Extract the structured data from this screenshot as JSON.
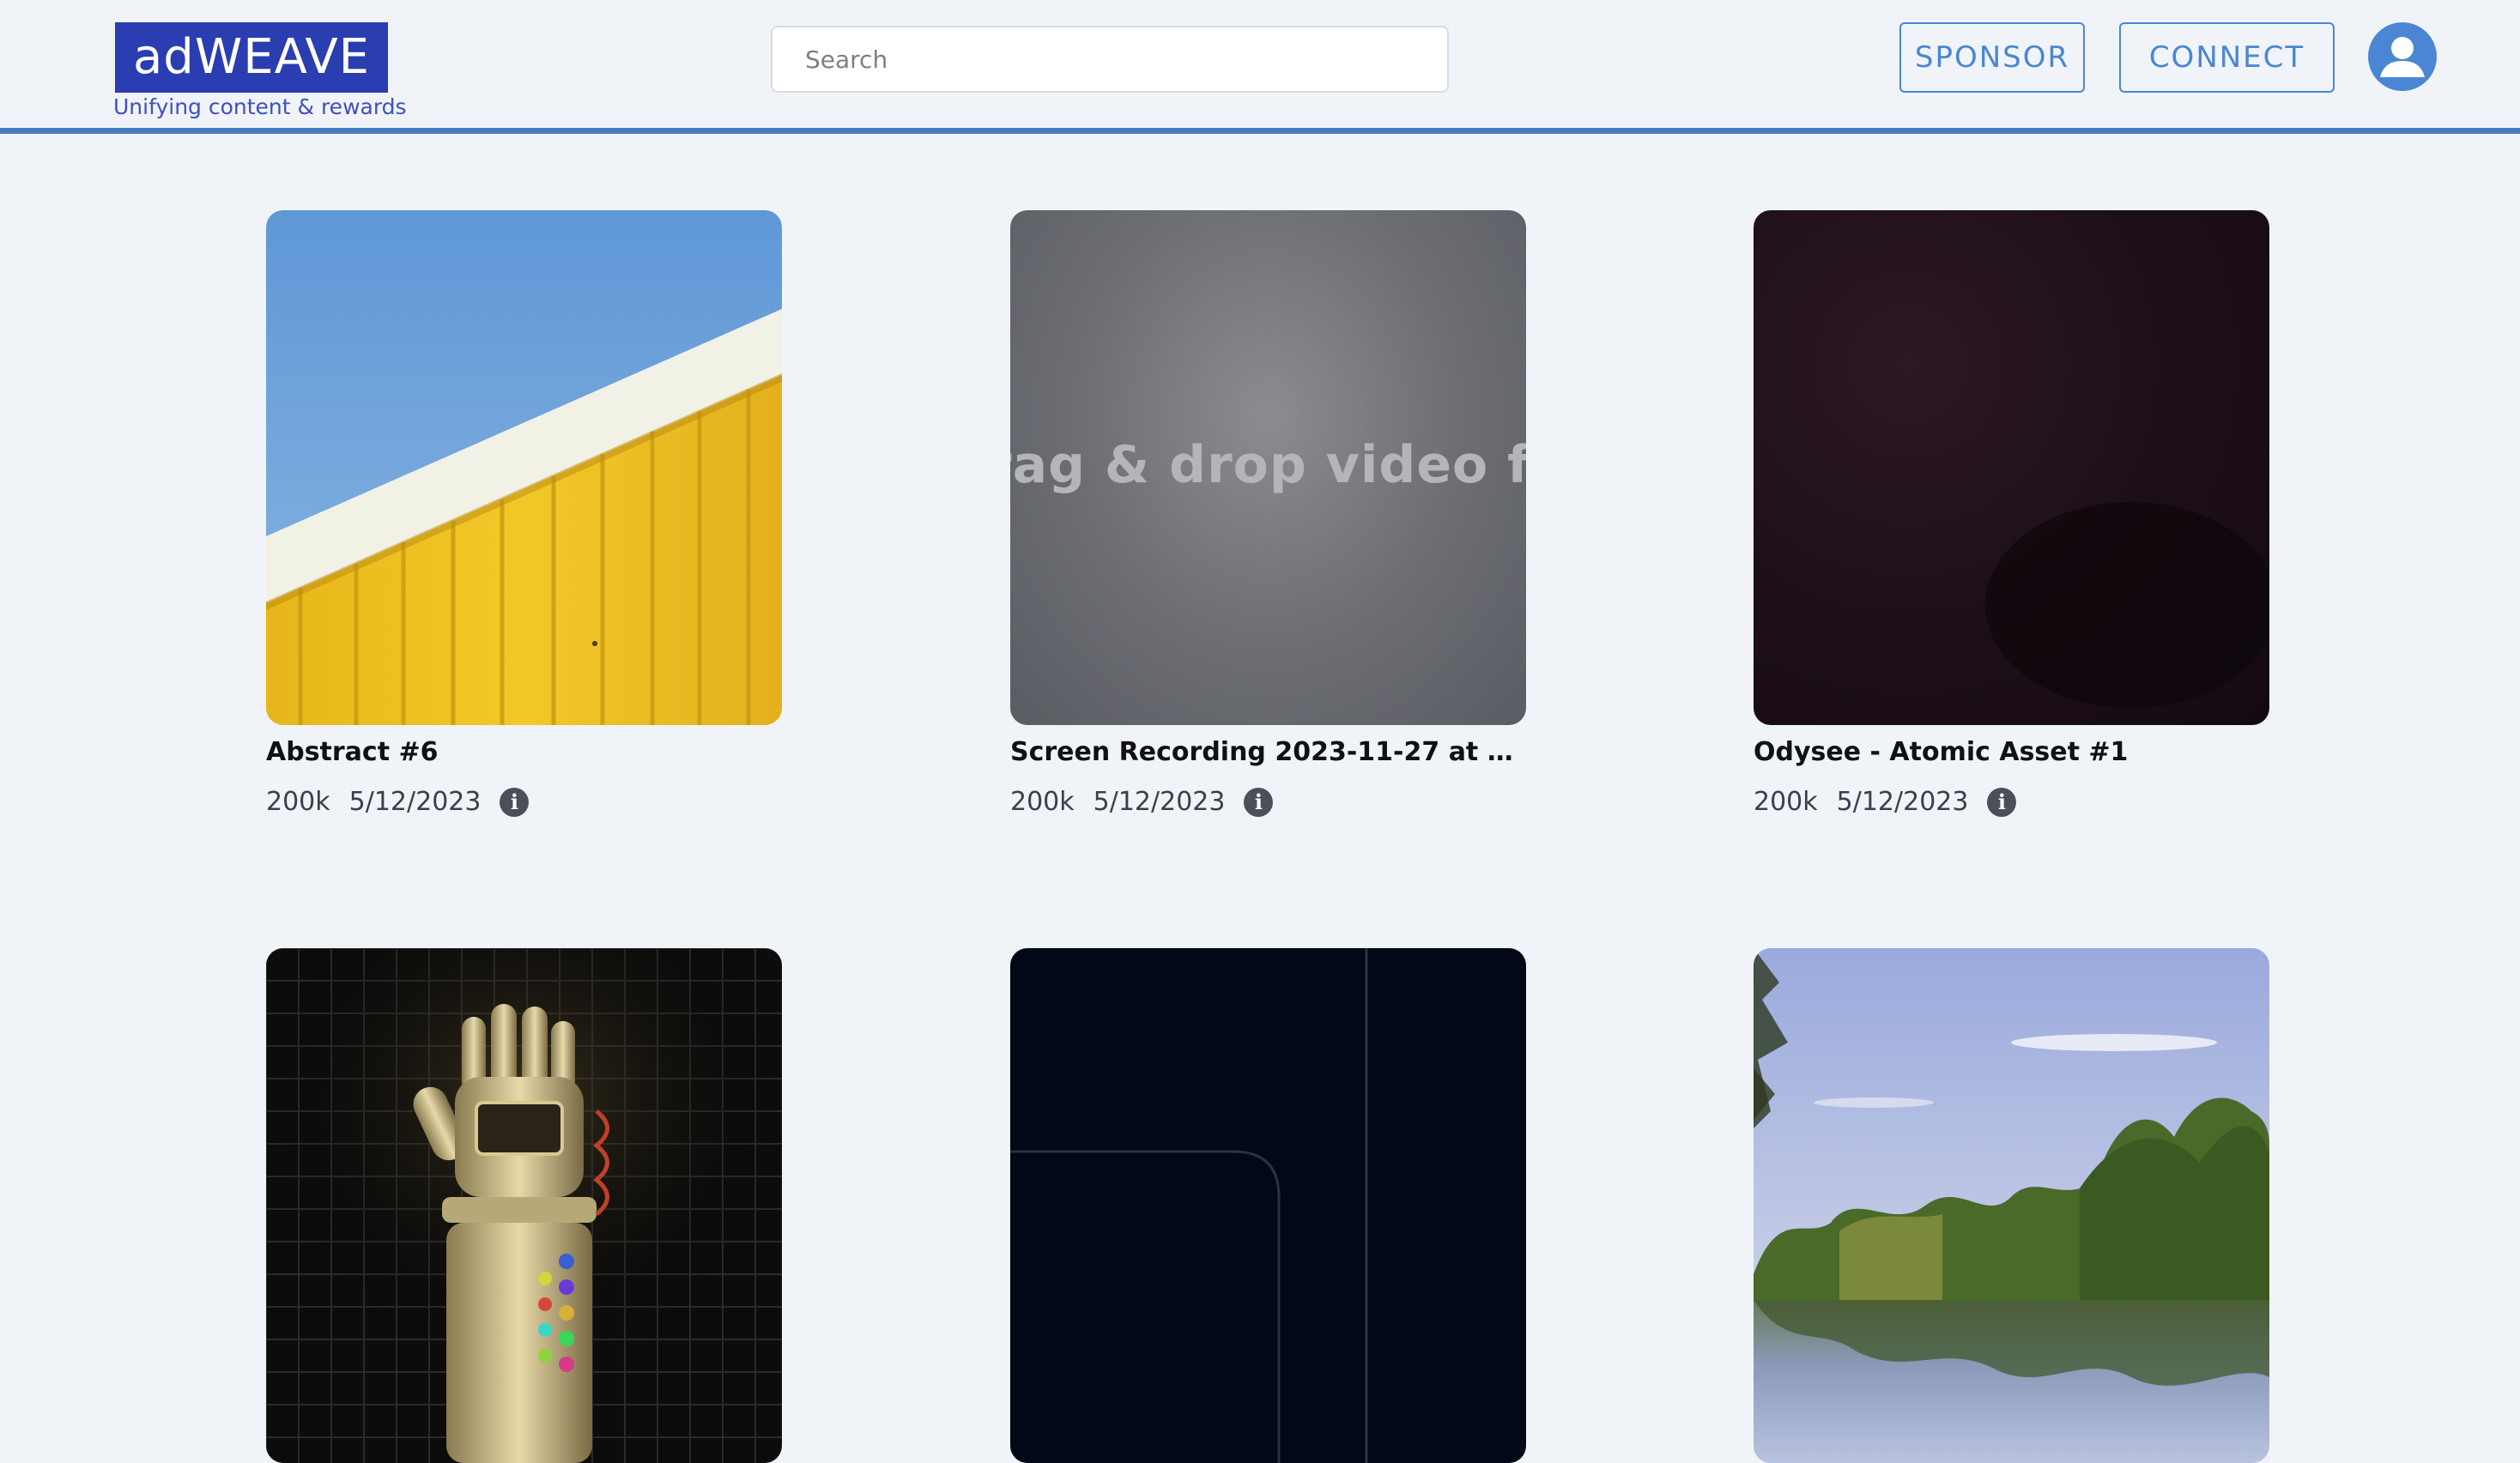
{
  "header": {
    "logo_text": "adWEAVE",
    "tagline": "Unifying content & rewards",
    "search_placeholder": "Search",
    "sponsor_label": "SPONSOR",
    "connect_label": "CONNECT"
  },
  "cards": [
    {
      "title": "Abstract #6",
      "views": "200k",
      "date": "5/12/2023",
      "info": "i"
    },
    {
      "title": "Screen Recording 2023-11-27 at 8.18.2...",
      "views": "200k",
      "date": "5/12/2023",
      "info": "i",
      "overlay_text": "rag & drop video fil"
    },
    {
      "title": "Odysee - Atomic Asset #1",
      "views": "200k",
      "date": "5/12/2023",
      "info": "i"
    },
    {
      "title": "",
      "views": "",
      "date": ""
    },
    {
      "title": "",
      "views": "",
      "date": ""
    },
    {
      "title": "",
      "views": "",
      "date": ""
    }
  ],
  "colors": {
    "background": "#f0f4f9",
    "logo_bg": "#2a3db1",
    "accent": "#4a86d3",
    "header_rule": "#4a7cc4"
  },
  "icons": {
    "avatar": "user-avatar-icon",
    "info": "info-icon"
  }
}
